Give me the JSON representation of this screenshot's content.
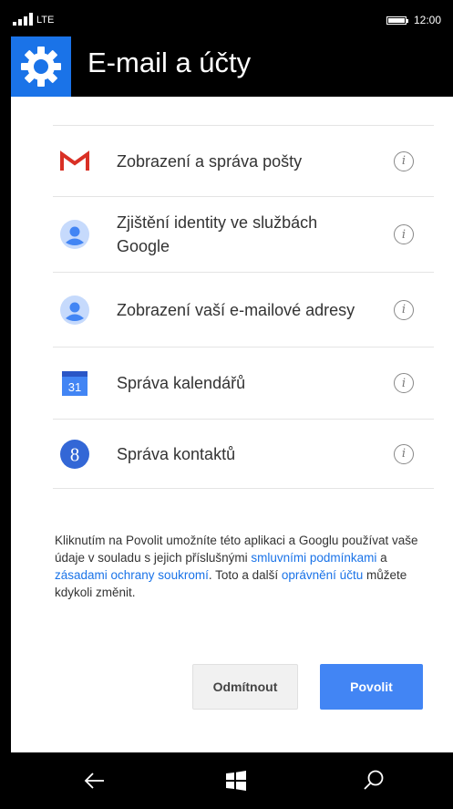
{
  "status_bar": {
    "network": "LTE",
    "time": "12:00"
  },
  "header": {
    "title": "E-mail a účty",
    "icon": "gear-icon",
    "accent_color": "#1a73e8"
  },
  "permissions": [
    {
      "label": "Zobrazení a správa pošty",
      "icon": "gmail-icon"
    },
    {
      "label": "Zjištění identity ve službách Google",
      "icon": "person-icon"
    },
    {
      "label": "Zobrazení vaší e-mailové adresy",
      "icon": "person-icon"
    },
    {
      "label": "Správa kalendářů",
      "icon": "calendar-icon",
      "icon_text": "31"
    },
    {
      "label": "Správa kontaktů",
      "icon": "google-plus-icon",
      "icon_text": "8"
    }
  ],
  "disclaimer": {
    "part1": "Kliknutím na Povolit umožníte této aplikaci a Googlu používat vaše údaje v souladu s jejich příslušnými ",
    "link1": "smluvními podmínkami",
    "part2": " a ",
    "link2": "zásadami ochrany soukromí",
    "part3": ". Toto a další ",
    "link3": "oprávnění účtu",
    "part4": " můžete kdykoli změnit."
  },
  "buttons": {
    "deny_label": "Odmítnout",
    "allow_label": "Povolit"
  },
  "nav": {
    "back": "back-arrow-icon",
    "home": "windows-logo-icon",
    "search": "search-icon"
  }
}
